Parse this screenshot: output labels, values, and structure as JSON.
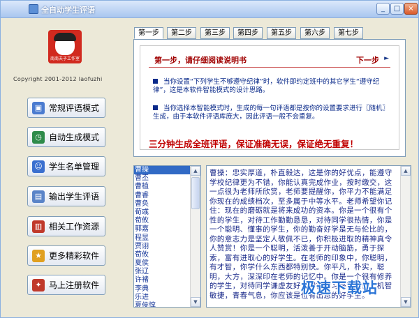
{
  "window": {
    "title": "全自动学生评语",
    "minimize": "_",
    "maximize": "□",
    "close": "×"
  },
  "sidebar": {
    "logo_caption": "南南夫子工作室",
    "copyright": "Copyright 2001-2012 laofuzhi",
    "buttons": [
      {
        "label": "常规评语模式",
        "icon": "computer-icon",
        "color": "#4a7bd0",
        "glyph": "▣"
      },
      {
        "label": "自动生成模式",
        "icon": "clock-icon",
        "color": "#2e8b4a",
        "glyph": "◷"
      },
      {
        "label": "学生名单管理",
        "icon": "users-icon",
        "color": "#3a6fcf",
        "glyph": "☺"
      },
      {
        "label": "输出学生评语",
        "icon": "output-icon",
        "color": "#5a84c8",
        "glyph": "▤"
      },
      {
        "label": "相关工作资源",
        "icon": "book-icon",
        "color": "#c0392b",
        "glyph": "▥"
      },
      {
        "label": "更多精彩软件",
        "icon": "star-icon",
        "color": "#e0a020",
        "glyph": "★"
      },
      {
        "label": "马上注册软件",
        "icon": "register-icon",
        "color": "#c0392b",
        "glyph": "✦"
      }
    ]
  },
  "tabs": [
    "第一步",
    "第二步",
    "第三步",
    "第四步",
    "第五步",
    "第六步",
    "第七步"
  ],
  "guide": {
    "heading": "第一步，请仔细阅读说明书",
    "next": "下一步",
    "next_arrow": "►",
    "para1": "当你设置“下列学生不够遵守纪律”时，软件即约定班中的其它学生“遵守纪律”，这是本软件智能模式的设计思路。",
    "para2": "当你选择本智能模式时，生成的每一句评语都是按你的设置要求进行〖随机〗生成，由于本软件评语库庞大，因此评语一般不会重复。",
    "slogan": "三分钟生成全班评语，保证准确无误，保证绝无重复！"
  },
  "students": [
    "曹操",
    "曹丕",
    "曹植",
    "曹睿",
    "曹奂",
    "荀彧",
    "荀攸",
    "郭嘉",
    "程昱",
    "贾诩",
    "荀攸",
    "夏侯",
    "张辽",
    "许褚",
    "李典",
    "乐进",
    "夏侯惇",
    "夏侯渊",
    "典韦"
  ],
  "comment": "曹操：忠实厚道，朴直毅达，这是你的好优点，能遵守学校纪律更为不错，你能认真完成作业，按时缴交，这一点很为老师所欣赏，老师要提醒你，你平力不能满足你现在的成绩档次，至多属于中等水平。老师希望你记住：现在的磨砺就是将来成功的资本。你是一个很有个性的学生，对待工作勤勤恳恳，对待同学很热情，你是一个聪明、懂事的学生，你的勤奋好学是无与伦比的，你的意志力是坚定人敬佩不已，你积极进取的精神真令人赞赏！你是一个聪明，活泼善于开动脑筋，勇于探索，富有进取心的好学生。在老师的印象中，你聪明，有才智，你学什么东西都特别快。你平凡，朴实，聪明，大方，深深印在老师的记忆中。你是一个很有修养的学生，对待同学谦虚友好，对待学习毫不怠慢。机智敏捷，青春气息，你应该是位有出息的好学生。",
  "watermark": "极速下载站"
}
